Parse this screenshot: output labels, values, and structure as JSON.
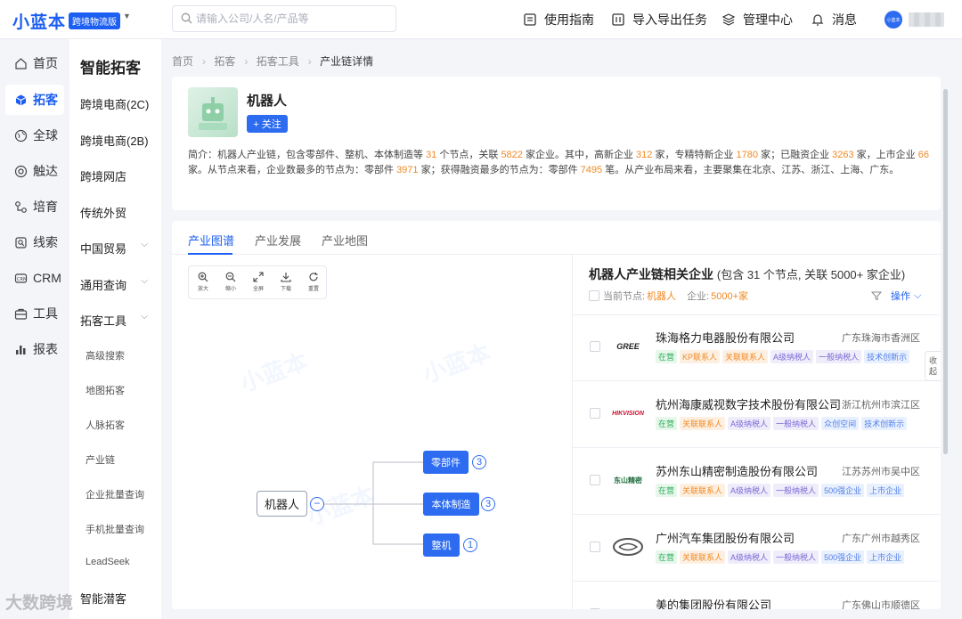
{
  "header": {
    "logo": "小蓝本",
    "edition": "跨境物流版",
    "search_placeholder": "请输入公司/人名/产品等",
    "nav": [
      "使用指南",
      "导入导出任务",
      "管理中心",
      "消息"
    ],
    "avatar_text": "小蓝本"
  },
  "rail": [
    "首页",
    "拓客",
    "全球",
    "触达",
    "培育",
    "线索",
    "CRM",
    "工具",
    "报表"
  ],
  "subnav": {
    "title": "智能拓客",
    "items": [
      "跨境电商(2C)",
      "跨境电商(2B)",
      "跨境网店",
      "传统外贸",
      "中国贸易",
      "通用查询",
      "拓客工具"
    ],
    "children": [
      "高级搜索",
      "地图拓客",
      "人脉拓客",
      "产业链",
      "企业批量查询",
      "手机批量查询",
      "LeadSeek",
      "智能潜客"
    ]
  },
  "breadcrumb": [
    "首页",
    "拓客",
    "拓客工具",
    "产业链详情"
  ],
  "industry": {
    "name": "机器人",
    "follow_label": "+ 关注",
    "intro_label": "简介：",
    "intro_parts": [
      "机器人产业链，包含零部件、整机、本体制造等 ",
      "31",
      " 个节点，关联 ",
      "5822",
      " 家企业。其中，高新企业 ",
      "312",
      " 家，专精特新企业 ",
      "1780",
      " 家；已融资企业 ",
      "3263",
      " 家，上市企业 ",
      "66",
      " 家。从节点来看，企业数最多的节点为：零部件 ",
      "3971",
      " 家；获得融资最多的节点为：零部件 ",
      "7495",
      " 笔。从产业布局来看，主要聚集在北京、江苏、浙江、上海、广东。"
    ]
  },
  "tabs": [
    "产业图谱",
    "产业发展",
    "产业地图"
  ],
  "tools": [
    "放大",
    "缩小",
    "全屏",
    "下载",
    "重置"
  ],
  "watermark": "小蓝本",
  "mindmap": {
    "root": "机器人",
    "collapse_symbol": "−",
    "nodes": [
      {
        "label": "零部件",
        "count": "3"
      },
      {
        "label": "本体制造",
        "count": "3"
      },
      {
        "label": "整机",
        "count": "1"
      }
    ]
  },
  "right_panel": {
    "title": "机器人产业链相关企业",
    "subtitle": "(包含 31 个节点, 关联 5000+ 家企业)",
    "current_node_label": "当前节点:",
    "current_node": "机器人",
    "company_label": "企业:",
    "company_count": "5000+家",
    "ops_label": "操作"
  },
  "companies": [
    {
      "name": "珠海格力电器股份有限公司",
      "location": "广东珠海市香洲区",
      "logo": "GREE",
      "tags": [
        {
          "t": "在营",
          "c": "green"
        },
        {
          "t": "KP联系人",
          "c": "orange"
        },
        {
          "t": "关联联系人",
          "c": "orange"
        },
        {
          "t": "A级纳税人",
          "c": "purple"
        },
        {
          "t": "一般纳税人",
          "c": "purple"
        },
        {
          "t": "技术创新示",
          "c": "blue"
        }
      ]
    },
    {
      "name": "杭州海康威视数字技术股份有限公司",
      "location": "浙江杭州市滨江区",
      "logo": "HIKVISION",
      "tags": [
        {
          "t": "在营",
          "c": "green"
        },
        {
          "t": "关联联系人",
          "c": "orange"
        },
        {
          "t": "A级纳税人",
          "c": "purple"
        },
        {
          "t": "一般纳税人",
          "c": "purple"
        },
        {
          "t": "众创空间",
          "c": "blue"
        },
        {
          "t": "技术创新示",
          "c": "blue"
        }
      ]
    },
    {
      "name": "苏州东山精密制造股份有限公司",
      "location": "江苏苏州市吴中区",
      "logo": "东山精密",
      "tags": [
        {
          "t": "在营",
          "c": "green"
        },
        {
          "t": "关联联系人",
          "c": "orange"
        },
        {
          "t": "A级纳税人",
          "c": "purple"
        },
        {
          "t": "一般纳税人",
          "c": "purple"
        },
        {
          "t": "500强企业",
          "c": "blue"
        },
        {
          "t": "上市企业",
          "c": "blue"
        }
      ]
    },
    {
      "name": "广州汽车集团股份有限公司",
      "location": "广东广州市越秀区",
      "logo": "GAC",
      "tags": [
        {
          "t": "在营",
          "c": "green"
        },
        {
          "t": "关联联系人",
          "c": "orange"
        },
        {
          "t": "A级纳税人",
          "c": "purple"
        },
        {
          "t": "一般纳税人",
          "c": "purple"
        },
        {
          "t": "500强企业",
          "c": "blue"
        },
        {
          "t": "上市企业",
          "c": "blue"
        }
      ]
    },
    {
      "name": "美的集团股份有限公司",
      "location": "广东佛山市顺德区",
      "logo": "",
      "tags": []
    }
  ],
  "collapse_tab": "收起",
  "footer_watermark": "大数跨境",
  "colors": {
    "accent": "#1d5ff2",
    "highlight": "#f08a24",
    "node": "#2d6cf0"
  }
}
